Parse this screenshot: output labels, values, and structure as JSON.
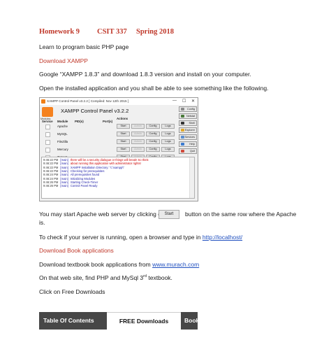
{
  "header": {
    "homework": "Homework 9",
    "course": "CSIT 337",
    "semester": "Spring 2018"
  },
  "intro": "Learn to program basic PHP page",
  "section_xampp": "Download XAMPP",
  "google_text": "Google “XAMPP 1.8.3” and download 1.8.3  version and install on your computer.",
  "open_text": "Open the installed application and you shall be able to see something like the following.",
  "xampp_window": {
    "title": "XAMPP Control Panel v3.2.2   [ Compiled: Nov 12th 2015 ]",
    "window_controls": [
      "—",
      "☐",
      "✕"
    ],
    "logo_label": "Modules",
    "panel_title": "XAMPP Control Panel v3.2.2",
    "col_service": "Service",
    "col_module": "Module",
    "col_pid": "PID(s)",
    "col_ports": "Port(s)",
    "col_actions": "Actions",
    "modules": [
      {
        "name": "Apache",
        "start": "Start",
        "admin": "Admin",
        "config": "Config",
        "logs": "Logs"
      },
      {
        "name": "MySQL",
        "start": "Start",
        "admin": "Admin",
        "config": "Config",
        "logs": "Logs"
      },
      {
        "name": "FileZilla",
        "start": "Start",
        "admin": "Admin",
        "config": "Config",
        "logs": "Logs"
      },
      {
        "name": "Mercury",
        "start": "Start",
        "admin": "Admin",
        "config": "Config",
        "logs": "Logs"
      },
      {
        "name": "Tomcat",
        "start": "Start",
        "admin": "Admin",
        "config": "Config",
        "logs": "Logs"
      }
    ],
    "side_buttons": [
      {
        "label": "Config",
        "color": "#8a8a8a"
      },
      {
        "label": "Netstat",
        "color": "#4a7a3a"
      },
      {
        "label": "Shell",
        "color": "#333333"
      },
      {
        "label": "Explorer",
        "color": "#e2a829"
      },
      {
        "label": "Services",
        "color": "#5a8fd0"
      },
      {
        "label": "Help",
        "color": "#3c7bd0"
      },
      {
        "label": "Quit",
        "color": "#d04a3c"
      }
    ],
    "log": [
      {
        "time": "9:46:22 PM",
        "module": "[main]",
        "msg": "there will be a security dialogue or things will break! So think",
        "tone": "red"
      },
      {
        "time": "9:46:22 PM",
        "module": "[main]",
        "msg": "about running this application with administrator rights!",
        "tone": "red"
      },
      {
        "time": "9:46:22 PM",
        "module": "[main]",
        "msg": "XAMPP Installation Directory: \"c:\\xampp\\\"",
        "tone": "normal"
      },
      {
        "time": "9:46:22 PM",
        "module": "[main]",
        "msg": "Checking for prerequisites",
        "tone": "normal"
      },
      {
        "time": "9:46:24 PM",
        "module": "[main]",
        "msg": "All prerequisites found",
        "tone": "normal"
      },
      {
        "time": "9:46:24 PM",
        "module": "[main]",
        "msg": "Initializing Modules",
        "tone": "normal"
      },
      {
        "time": "9:46:26 PM",
        "module": "[main]",
        "msg": "Starting Check-Timer",
        "tone": "normal"
      },
      {
        "time": "9:46:26 PM",
        "module": "[main]",
        "msg": "Control Panel Ready",
        "tone": "normal"
      }
    ]
  },
  "start_line_a": "You may start Apache web server by clicking on",
  "start_button": "Start",
  "start_line_b": "button on the same row where the Apache",
  "start_line_c": "is.",
  "check_text": "To check if your server is running, open a browser and type in",
  "localhost_link": "http://localhost/",
  "section_book": "Download Book applications",
  "download_text": "Download textbook book applications from",
  "murach_link": "www.murach.com",
  "php_text_a": "On that web site, find PHP and MySql 3",
  "php_text_sup": "rd",
  "php_text_b": " textbook.",
  "free_text": "Click on Free Downloads",
  "tabs": [
    {
      "label": "Table Of Contents",
      "style": "dark"
    },
    {
      "label": "FREE Downloads",
      "style": "light"
    },
    {
      "label": "Book",
      "style": "dark"
    }
  ]
}
